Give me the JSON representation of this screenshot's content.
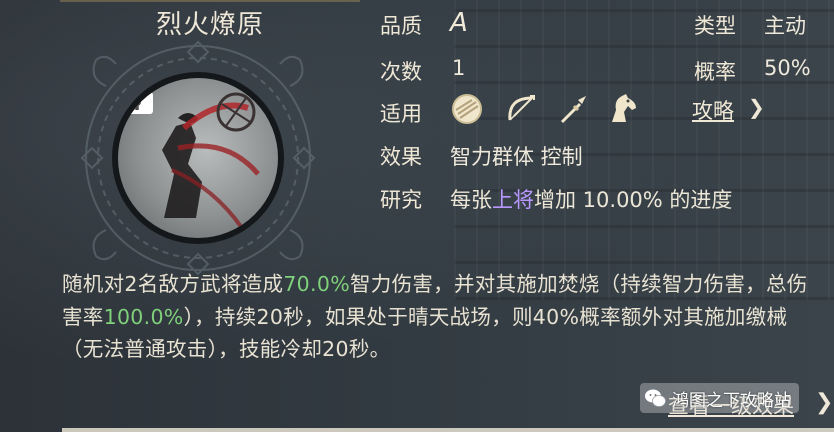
{
  "skill": {
    "name": "烈火燎原"
  },
  "attributes": {
    "quality_label": "品质",
    "quality_value": "A",
    "type_label": "类型",
    "type_value": "主动",
    "count_label": "次数",
    "count_value": "1",
    "rate_label": "概率",
    "rate_value": "50%",
    "apply_label": "适用",
    "apply_icons": [
      "shield-icon",
      "bow-icon",
      "spear-icon",
      "horse-icon"
    ],
    "guide_label": "攻略",
    "effect_label": "效果",
    "effect_value": "智力群体 控制",
    "research_label": "研究",
    "research_prefix": "每张",
    "research_highlight": "上将",
    "research_suffix": "增加 10.00% 的进度"
  },
  "description": {
    "p1": "随机对2名敌方武将造成",
    "v1": "70.0%",
    "p2": "智力伤害，并对其施加焚烧（持续智力伤害，总伤害率",
    "v2": "100.0%",
    "p3": "），持续20秒，如果处于晴天战场，则40%概率额外对其施加缴械（无法普通攻击），技能冷却20秒。"
  },
  "footer": {
    "view_more": "查看一级效果"
  },
  "watermark": {
    "text": "鸿图之下攻略站"
  },
  "colors": {
    "highlight_purple": "#b898ff",
    "highlight_green": "#7fd07a",
    "background": "#2b3138"
  }
}
